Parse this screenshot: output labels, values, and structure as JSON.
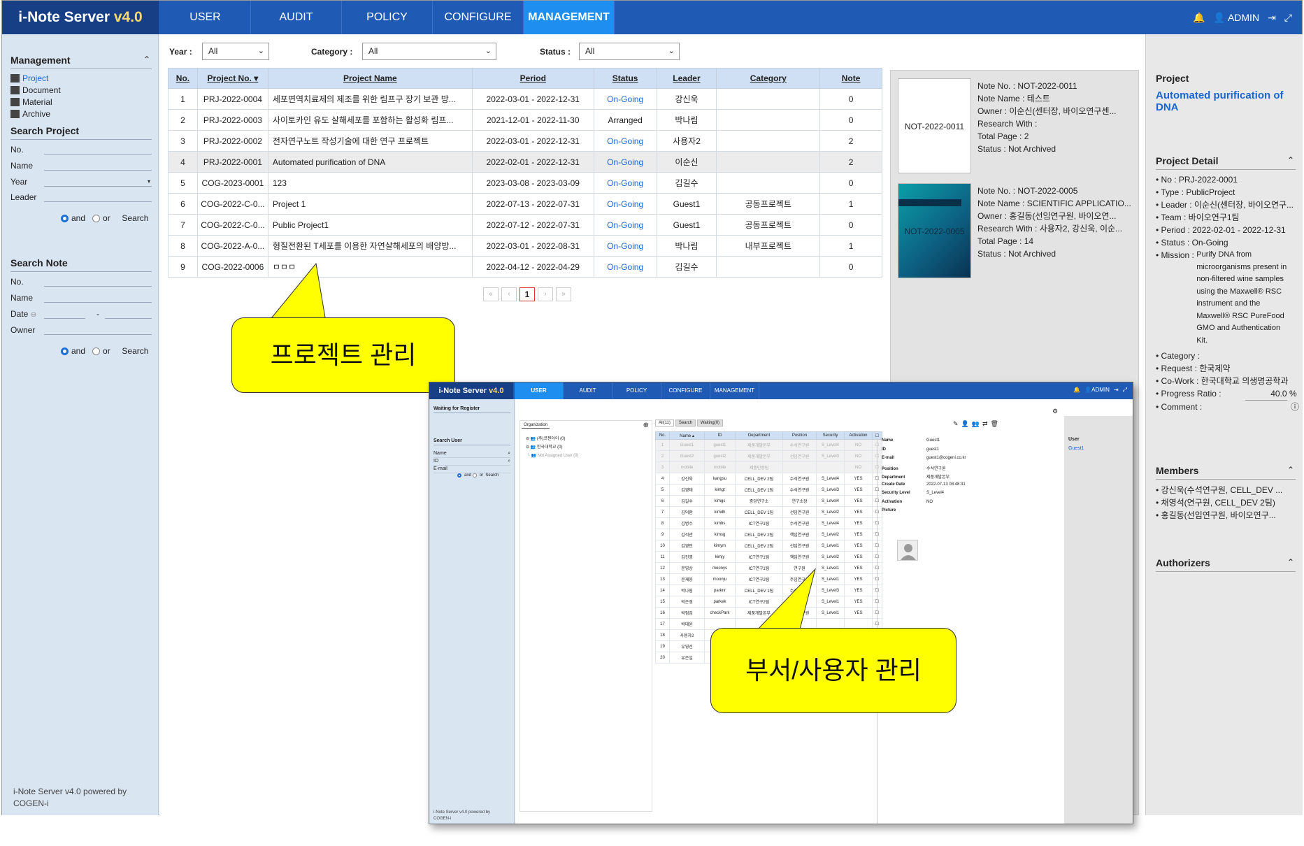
{
  "app": {
    "name": "i-Note Server",
    "version": "v4.0"
  },
  "nav": [
    "USER",
    "AUDIT",
    "POLICY",
    "CONFIGURE",
    "MANAGEMENT"
  ],
  "nav_active": "MANAGEMENT",
  "user": "ADMIN",
  "sidebar": {
    "management_title": "Management",
    "tree": [
      "Project",
      "Document",
      "Material",
      "Archive"
    ],
    "search_project_title": "Search Project",
    "project_fields": [
      "No.",
      "Name",
      "Year",
      "Leader"
    ],
    "search_note_title": "Search Note",
    "note_fields": [
      "No.",
      "Name",
      "Date",
      "Owner"
    ],
    "and": "and",
    "or": "or",
    "search": "Search",
    "date_sep": "-",
    "footer": "i-Note Server v4.0 powered by COGEN-i"
  },
  "filters": {
    "year_label": "Year :",
    "year_value": "All",
    "category_label": "Category :",
    "category_value": "All",
    "status_label": "Status :",
    "status_value": "All"
  },
  "table": {
    "headers": [
      "No.",
      "Project No.",
      "Project Name",
      "Period",
      "Status",
      "Leader",
      "Category",
      "Note"
    ],
    "sort_indicator": "▾",
    "rows": [
      [
        "1",
        "PRJ-2022-0004",
        "세포면역치료제의 제조를 위한 림프구 장기 보관 방...",
        "2022-03-01 - 2022-12-31",
        "On-Going",
        "강신욱",
        "",
        "0"
      ],
      [
        "2",
        "PRJ-2022-0003",
        "사이토카인 유도 살해세포를 포함하는 활성화 림프...",
        "2021-12-01 - 2022-11-30",
        "Arranged",
        "박나림",
        "",
        "0"
      ],
      [
        "3",
        "PRJ-2022-0002",
        "전자연구노트 작성기술에 대한 연구 프로젝트",
        "2022-03-01 - 2022-12-31",
        "On-Going",
        "사용자2",
        "",
        "2"
      ],
      [
        "4",
        "PRJ-2022-0001",
        "Automated purification of DNA",
        "2022-02-01 - 2022-12-31",
        "On-Going",
        "이순신",
        "",
        "2"
      ],
      [
        "5",
        "COG-2023-0001",
        "123",
        "2023-03-08 - 2023-03-09",
        "On-Going",
        "김길수",
        "",
        "0"
      ],
      [
        "6",
        "COG-2022-C-0...",
        "Project 1",
        "2022-07-13 - 2022-07-31",
        "On-Going",
        "Guest1",
        "공동프로젝트",
        "1"
      ],
      [
        "7",
        "COG-2022-C-0...",
        "Public Project1",
        "2022-07-12 - 2022-07-31",
        "On-Going",
        "Guest1",
        "공동프로젝트",
        "0"
      ],
      [
        "8",
        "COG-2022-A-0...",
        "형질전환된 T세포를 이용한 자연살해세포의 배양방...",
        "2022-03-01 - 2022-08-31",
        "On-Going",
        "박나림",
        "내부프로젝트",
        "1"
      ],
      [
        "9",
        "COG-2022-0006",
        "ㅁㅁㅁ",
        "2022-04-12 - 2022-04-29",
        "On-Going",
        "김길수",
        "",
        "0"
      ]
    ],
    "highlight_row": 3
  },
  "pager": {
    "first": "«",
    "prev": "‹",
    "current": "1",
    "next": "›",
    "last": "»"
  },
  "notes": [
    {
      "thumb": "NOT-2022-0011",
      "no": "Note No. : NOT-2022-0011",
      "name": "Note Name : 테스트",
      "owner": "Owner : 이순신(센터장, 바이오연구센...",
      "research": "Research With :",
      "pages": "Total Page : 2",
      "status": "Status : Not Archived"
    },
    {
      "thumb": "NOT-2022-0005",
      "no": "Note No. : NOT-2022-0005",
      "name": "Note Name : SCIENTIFIC APPLICATIO...",
      "owner": "Owner : 홍길동(선임연구원, 바이오연...",
      "research": "Research With : 사용자2, 강신욱, 이순...",
      "pages": "Total Page : 14",
      "status": "Status : Not Archived"
    }
  ],
  "right": {
    "project_title": "Project",
    "project_name": "Automated purification of DNA",
    "detail_title": "Project Detail",
    "detail": [
      "No : PRJ-2022-0001",
      "Type : PublicProject",
      "Leader : 이순신(센터장, 바이오연구...",
      "Team : 바이오연구1팀",
      "Period : 2022-02-01 - 2022-12-31",
      "Status : On-Going"
    ],
    "mission_label": "Mission :",
    "mission_text": [
      "Purify DNA from",
      "microorganisms present in",
      "non-filtered wine samples",
      "using the Maxwell® RSC",
      "instrument and the",
      "Maxwell® RSC PureFood",
      "GMO and Authentication",
      "Kit."
    ],
    "detail2": [
      "Category :",
      "Request : 한국제약",
      "Co-Work : 한국대학교 의생명공학과"
    ],
    "progress_label": "Progress Ratio :",
    "progress_value": "40.0",
    "progress_unit": "%",
    "comment_label": "Comment :",
    "members_title": "Members",
    "members": [
      "강신욱(수석연구원, CELL_DEV ...",
      "채영석(연구원, CELL_DEV 2팀)",
      "홍길동(선임연구원, 바이오연구..."
    ],
    "authorizers_title": "Authorizers"
  },
  "callouts": {
    "project": "프로젝트 관리",
    "user": "부서/사용자 관리"
  },
  "overlay": {
    "nav": [
      "USER",
      "AUDIT",
      "POLICY",
      "CONFIGURE",
      "MANAGEMENT"
    ],
    "user": "ADMIN",
    "waiting_title": "Waiting for Register",
    "search_user_title": "Search User",
    "search_fields": [
      "Name",
      "ID",
      "E-mail"
    ],
    "and": "and",
    "or": "or",
    "search": "Search",
    "footer": "i-Note Server v4.0 powered by COGEN-i",
    "org_tab": "Organization",
    "org_tree": [
      "(주)코젠아이 (0)",
      "한국대학교 (0)",
      "Not Assigned User (0)"
    ],
    "tabs": [
      "All(11)",
      "Search",
      "Waiting(0)"
    ],
    "headers": [
      "No.",
      "Name ▴",
      "ID",
      "Department",
      "Position",
      "Security",
      "Activation"
    ],
    "rows": [
      [
        "1",
        "Guest1",
        "guest1",
        "제품개발본부",
        "수석연구원",
        "S_Level4",
        "NO"
      ],
      [
        "2",
        "Guest2",
        "guest2",
        "제품개발본부",
        "선임연구원",
        "S_Level3",
        "NO"
      ],
      [
        "3",
        "mobile",
        "mobile",
        "제품인증팀",
        "",
        "",
        "NO"
      ],
      [
        "4",
        "강신욱",
        "kangsu",
        "CELL_DEV 2팀",
        "수석연구원",
        "S_Level4",
        "YES"
      ],
      [
        "5",
        "김영태",
        "kimgt",
        "CELL_DEV 1팀",
        "수석연구원",
        "S_Level3",
        "YES"
      ],
      [
        "6",
        "김길수",
        "kimgs",
        "중앙연구소",
        "연구소장",
        "S_Level4",
        "YES"
      ],
      [
        "7",
        "김덕환",
        "kimdh",
        "CELL_DEV 1팀",
        "선임연구원",
        "S_Level2",
        "YES"
      ],
      [
        "8",
        "김병수",
        "kimbs",
        "ICT연구1팀",
        "수석연구원",
        "S_Level4",
        "YES"
      ],
      [
        "9",
        "김석관",
        "kimsg",
        "CELL_DEV 2팀",
        "책임연구원",
        "S_Level2",
        "YES"
      ],
      [
        "10",
        "김영민",
        "kimym",
        "CELL_DEV 2팀",
        "선임연구원",
        "S_Level1",
        "YES"
      ],
      [
        "11",
        "김진영",
        "kimjy",
        "ICT연구1팀",
        "책임연구원",
        "S_Level2",
        "YES"
      ],
      [
        "12",
        "문영상",
        "moonys",
        "ICT연구1팀",
        "연구원",
        "S_Level1",
        "YES"
      ],
      [
        "13",
        "문재웅",
        "moonju",
        "ICT연구2팀",
        "주임연구원",
        "S_Level1",
        "YES"
      ],
      [
        "14",
        "박나림",
        "parknr",
        "CELL_DEV 1팀",
        "수석연구원",
        "S_Level3",
        "YES"
      ],
      [
        "15",
        "박은경",
        "parkek",
        "ICT연구2팀",
        "연구원",
        "S_Level1",
        "YES"
      ],
      [
        "16",
        "박점검",
        "checkPark",
        "제품개발본부",
        "선임연구원",
        "S_Level1",
        "YES"
      ],
      [
        "17",
        "박태윤",
        "",
        "",
        "",
        "",
        ""
      ],
      [
        "18",
        "사용자2",
        "",
        "",
        "",
        "",
        ""
      ],
      [
        "19",
        "유영선",
        "",
        "",
        "",
        "",
        ""
      ],
      [
        "20",
        "유은일",
        "",
        "",
        "",
        "",
        ""
      ]
    ],
    "detail_labels": [
      "Name",
      "ID",
      "E-mail",
      "Position",
      "Department",
      "Create Date",
      "Security Level",
      "Activation",
      "Picture"
    ],
    "detail_values": [
      "Guest1",
      "guest1",
      "guest1@cogeni.co.kr",
      "수석연구원",
      "제품개발본부",
      "2022-07-13 08:48:31",
      "S_Level4",
      "NO",
      ""
    ],
    "right_title": "User",
    "right_value": "Guest1"
  },
  "colors": {
    "topbar": "#1f5bb4",
    "logo_bg": "#173f86",
    "active_tab": "#1e8ff0",
    "sidebar": "#dae5f2",
    "link": "#1a66d1",
    "callout": "#ffff00"
  }
}
